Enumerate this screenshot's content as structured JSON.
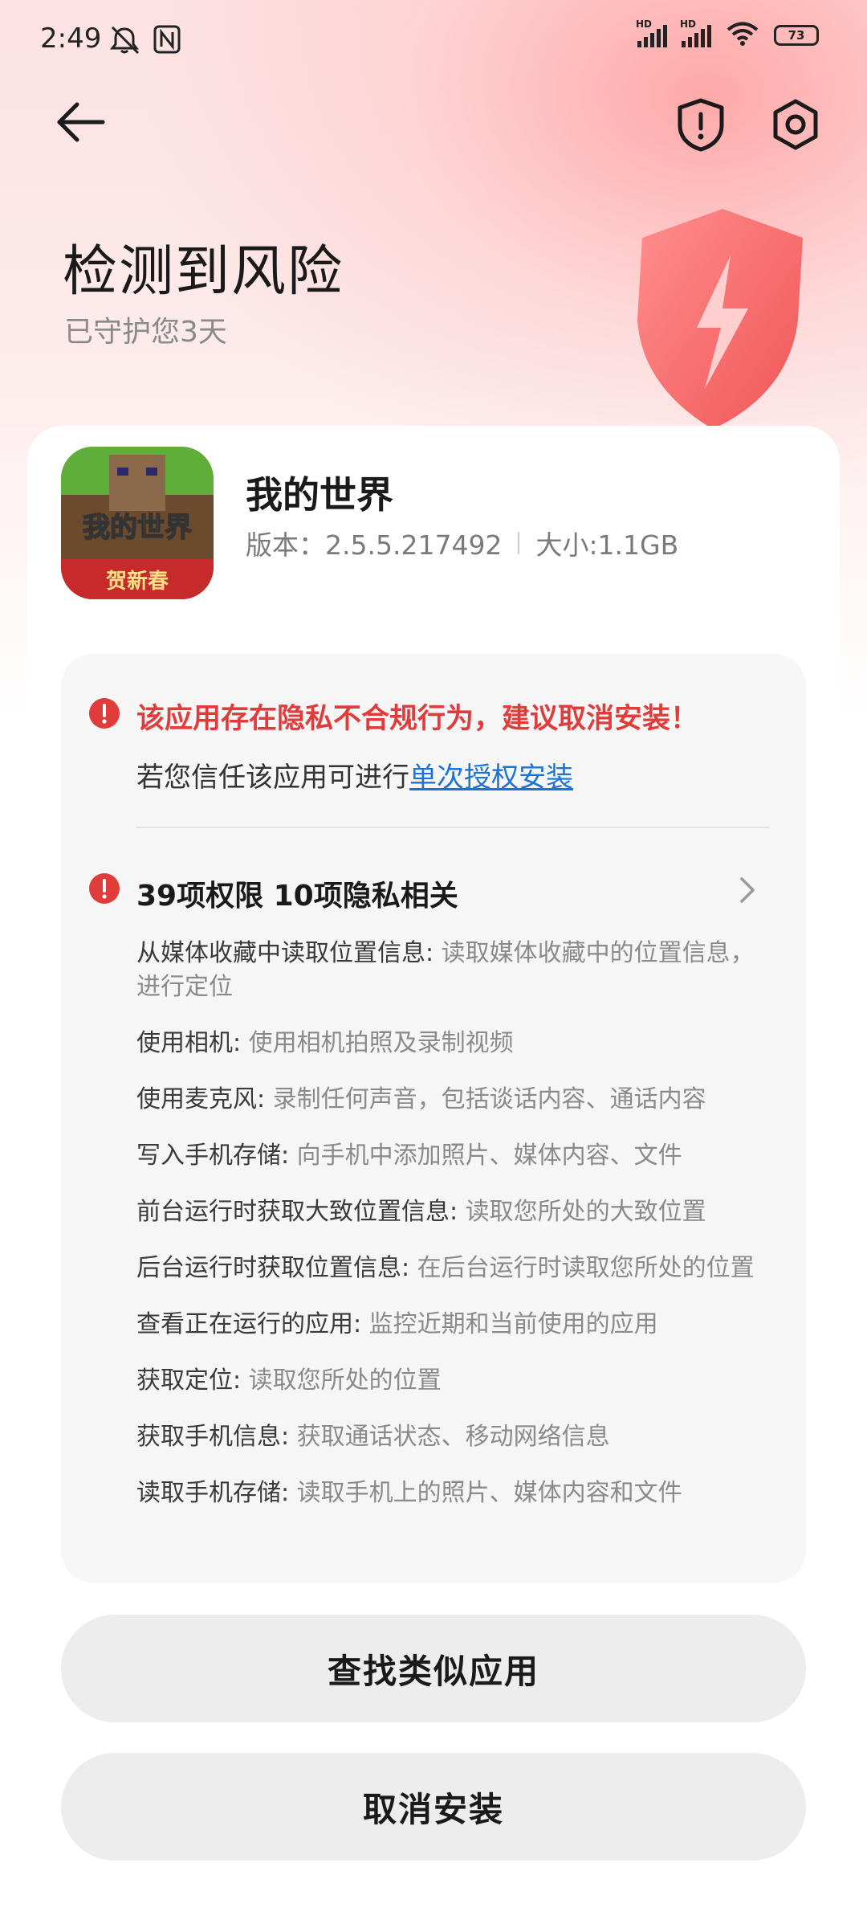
{
  "status_bar": {
    "time": "2:49",
    "signal_badge": "HD",
    "battery": "73"
  },
  "header": {
    "title": "检测到风险",
    "subtitle": "已守护您3天"
  },
  "app": {
    "name": "我的世界",
    "version": "版本：2.5.5.217492",
    "size": "大小:1.1GB",
    "icon_text": "我的世界",
    "icon_banner": "贺新春"
  },
  "warning": {
    "headline": "该应用存在隐私不合规行为，建议取消安装！",
    "trust_prefix": "若您信任该应用可进行",
    "trust_link": "单次授权安装"
  },
  "permissions": {
    "summary": "39项权限 10项隐私相关",
    "items": [
      {
        "name": "从媒体收藏中读取位置信息:",
        "desc": "读取媒体收藏中的位置信息，进行定位"
      },
      {
        "name": "使用相机:",
        "desc": "使用相机拍照及录制视频"
      },
      {
        "name": "使用麦克风:",
        "desc": "录制任何声音，包括谈话内容、通话内容"
      },
      {
        "name": "写入手机存储:",
        "desc": "向手机中添加照片、媒体内容、文件"
      },
      {
        "name": "前台运行时获取大致位置信息:",
        "desc": "读取您所处的大致位置"
      },
      {
        "name": "后台运行时获取位置信息:",
        "desc": "在后台运行时读取您所处的位置"
      },
      {
        "name": "查看正在运行的应用:",
        "desc": "监控近期和当前使用的应用"
      },
      {
        "name": "获取定位:",
        "desc": "读取您所处的位置"
      },
      {
        "name": "获取手机信息:",
        "desc": "获取通话状态、移动网络信息"
      },
      {
        "name": "读取手机存储:",
        "desc": "读取手机上的照片、媒体内容和文件"
      }
    ]
  },
  "buttons": {
    "find_similar": "查找类似应用",
    "cancel_install": "取消安装"
  },
  "colors": {
    "danger": "#e03c3c",
    "link": "#1a73d9",
    "panel_bg": "#f6f6f6",
    "button_bg": "#ededed"
  }
}
